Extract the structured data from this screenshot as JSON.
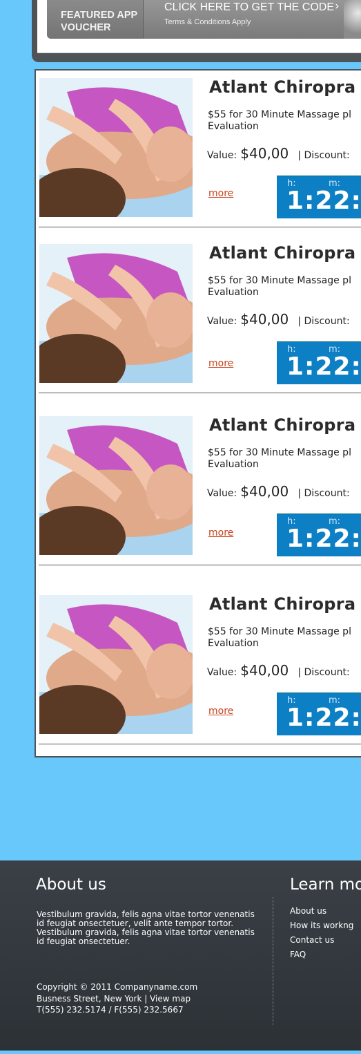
{
  "promo": {
    "featured_line1": "FEATURED APP",
    "featured_line2": "VOUCHER",
    "cta": "CLICK HERE TO GET THE CODE",
    "cta_arrow": "›",
    "terms": "Terms & Conditions Apply"
  },
  "deals": [
    {
      "title": "Atlant Chiropra",
      "desc_line1": "$55 for 30 Minute Massage pl",
      "desc_line2": "Evaluation",
      "value_label": "Value:",
      "value_amount": "$40,00",
      "discount_label": "| Discount:",
      "more": "more",
      "timer_h_label": "h:",
      "timer_m_label": "m:",
      "timer_value": "1:22:"
    },
    {
      "title": "Atlant Chiropra",
      "desc_line1": "$55 for 30 Minute Massage pl",
      "desc_line2": "Evaluation",
      "value_label": "Value:",
      "value_amount": "$40,00",
      "discount_label": "| Discount:",
      "more": "more",
      "timer_h_label": "h:",
      "timer_m_label": "m:",
      "timer_value": "1:22:"
    },
    {
      "title": "Atlant Chiropra",
      "desc_line1": "$55 for 30 Minute Massage pl",
      "desc_line2": "Evaluation",
      "value_label": "Value:",
      "value_amount": "$40,00",
      "discount_label": "| Discount:",
      "more": "more",
      "timer_h_label": "h:",
      "timer_m_label": "m:",
      "timer_value": "1:22:"
    },
    {
      "title": "Atlant Chiropra",
      "desc_line1": "$55 for 30 Minute Massage pl",
      "desc_line2": "Evaluation",
      "value_label": "Value:",
      "value_amount": "$40,00",
      "discount_label": "| Discount:",
      "more": "more",
      "timer_h_label": "h:",
      "timer_m_label": "m:",
      "timer_value": "1:22:"
    }
  ],
  "footer": {
    "about_title": "About us",
    "about_p1": "Vestibulum gravida, felis agna vitae tortor venenatis id feugiat onsectetuer, velit ante tempor tortor.",
    "about_p2": "Vestibulum gravida, felis agna vitae tortor venenatis id feugiat onsectetuer.",
    "copyright_line1": "Copyright © 2011 Companyname.com",
    "copyright_line2": "Busness Street, New York | View map",
    "copyright_line3": "T(555) 232.5174 / F(555) 232.5667",
    "learn_title": "Learn mo",
    "links": [
      "About us",
      "How its workng",
      "Contact us",
      "FAQ"
    ]
  },
  "colors": {
    "page_bg": "#69c8fb",
    "timer_bg": "#0d7fc4",
    "more_link": "#c8401a",
    "footer_bg": "#33393e"
  }
}
